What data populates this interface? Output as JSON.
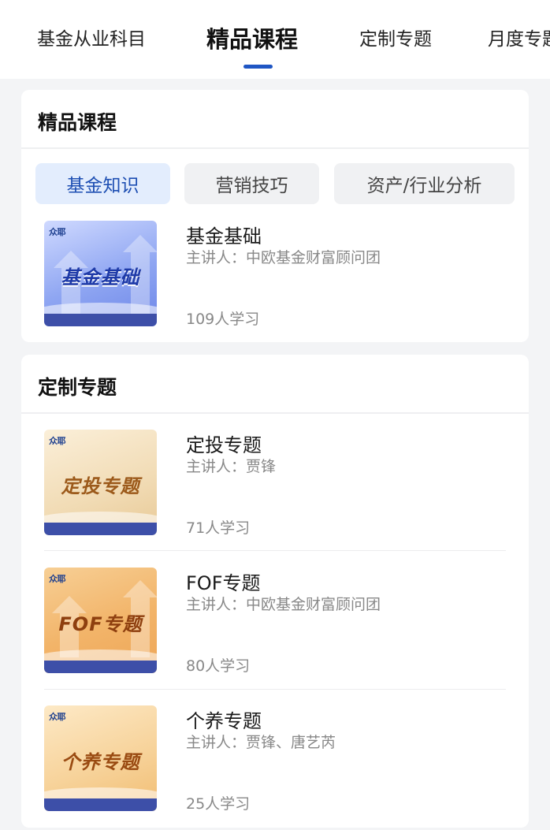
{
  "top_tabs": [
    {
      "label": "基金从业科目"
    },
    {
      "label": "精品课程"
    },
    {
      "label": "定制专题"
    },
    {
      "label": "月度专题"
    }
  ],
  "featured": {
    "title": "精品课程",
    "chips": [
      {
        "label": "基金知识"
      },
      {
        "label": "营销技巧"
      },
      {
        "label": "资产/行业分析"
      }
    ],
    "courses": [
      {
        "thumb_title": "基金基础",
        "thumb_logo": "众耶",
        "name": "基金基础",
        "lecturer": "主讲人：中欧基金财富顾问团",
        "learners": "109人学习"
      }
    ]
  },
  "custom": {
    "title": "定制专题",
    "courses": [
      {
        "thumb_title": "定投专题",
        "thumb_logo": "众耶",
        "name": "定投专题",
        "lecturer": "主讲人：贾锋",
        "learners": "71人学习"
      },
      {
        "thumb_title": "FOF专题",
        "thumb_logo": "众耶",
        "name": "FOF专题",
        "lecturer": "主讲人：中欧基金财富顾问团",
        "learners": "80人学习"
      },
      {
        "thumb_title": "个养专题",
        "thumb_logo": "众耶",
        "name": "个养专题",
        "lecturer": "主讲人：贾锋、唐艺芮",
        "learners": "25人学习"
      }
    ]
  },
  "colors": {
    "accent": "#1f56c4",
    "chip_active_bg": "#e3edfd",
    "chip_active_text": "#1e4fb3",
    "muted_text": "#888888"
  }
}
